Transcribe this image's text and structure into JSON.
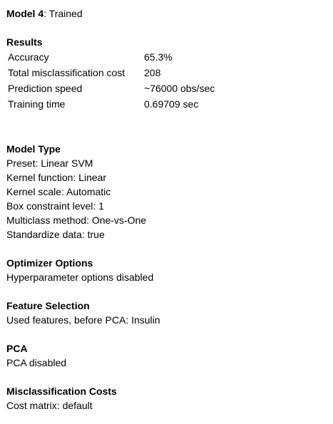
{
  "model": {
    "name": "Model 4",
    "status_sep": ": ",
    "status": "Trained"
  },
  "results": {
    "heading": "Results",
    "rows": [
      {
        "label": "Accuracy",
        "value": "65.3%"
      },
      {
        "label": "Total misclassification cost",
        "value": "208"
      },
      {
        "label": "Prediction speed",
        "value": "~76000 obs/sec"
      },
      {
        "label": "Training time",
        "value": "0.69709 sec"
      }
    ]
  },
  "model_type": {
    "heading": "Model Type",
    "lines": [
      "Preset: Linear SVM",
      "Kernel function: Linear",
      "Kernel scale: Automatic",
      "Box constraint level: 1",
      "Multiclass method: One-vs-One",
      "Standardize data: true"
    ]
  },
  "optimizer": {
    "heading": "Optimizer Options",
    "lines": [
      "Hyperparameter options disabled"
    ]
  },
  "feature_selection": {
    "heading": "Feature Selection",
    "lines": [
      "Used features, before PCA: Insulin"
    ]
  },
  "pca": {
    "heading": "PCA",
    "lines": [
      "PCA disabled"
    ]
  },
  "misclassification_costs": {
    "heading": "Misclassification Costs",
    "lines": [
      "Cost matrix: default"
    ]
  }
}
